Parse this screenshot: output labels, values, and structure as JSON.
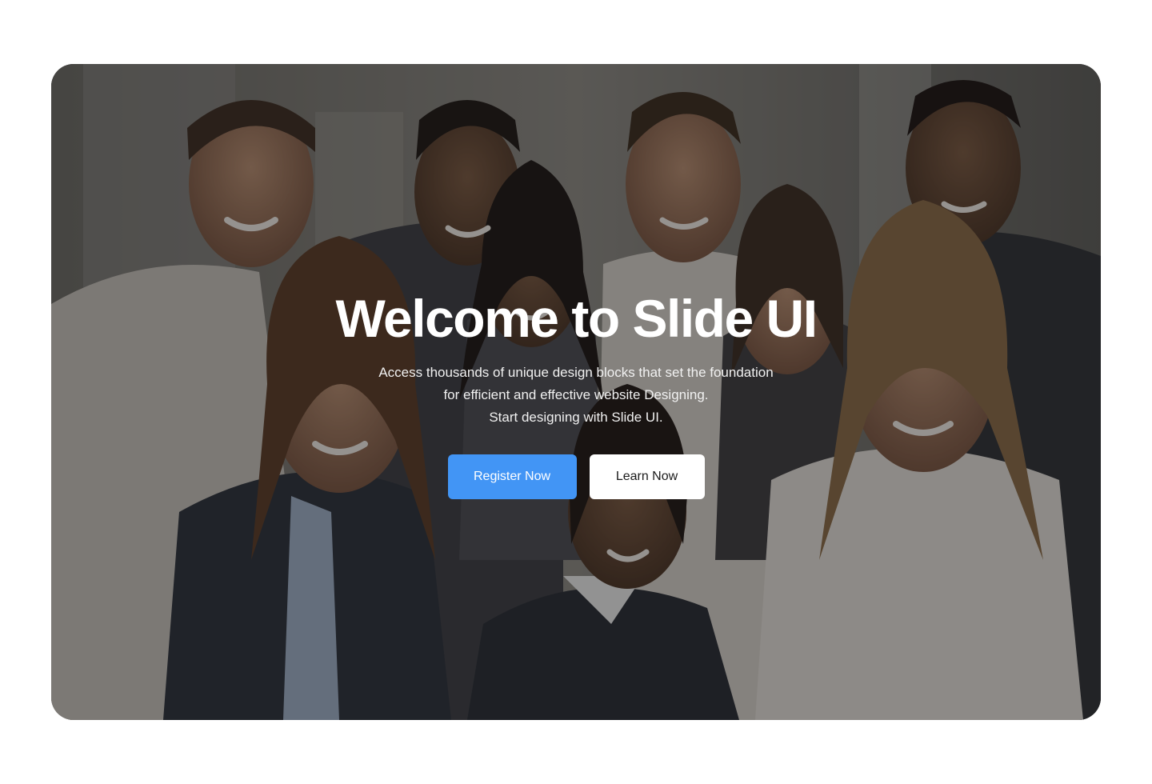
{
  "hero": {
    "title": "Welcome to Slide UI",
    "description_lines": [
      "Access thousands of unique design blocks that set the foundation",
      "for efficient and effective website Designing.",
      "Start designing with Slide UI."
    ],
    "primary_button": "Register Now",
    "secondary_button": "Learn Now",
    "background_image": "team-photo",
    "colors": {
      "primary": "#4295F5",
      "secondary_bg": "#FFFFFF",
      "overlay": "#121214",
      "title_text": "#FFFFFF"
    }
  }
}
